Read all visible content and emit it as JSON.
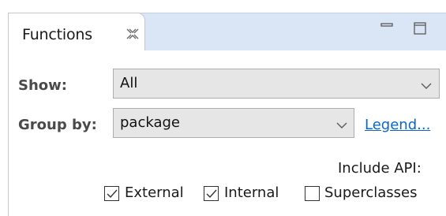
{
  "view": {
    "tab_title": "Functions",
    "close_icon": "close-x-icon",
    "minimize_icon": "minimize-icon",
    "maximize_icon": "maximize-icon"
  },
  "show": {
    "label": "Show:",
    "value": "All"
  },
  "group_by": {
    "label": "Group by:",
    "value": "package"
  },
  "legend_link": "Legend...",
  "include_api": {
    "label": "Include API:",
    "options": [
      {
        "label": "External",
        "checked": true
      },
      {
        "label": "Internal",
        "checked": true
      },
      {
        "label": "Superclasses",
        "checked": false
      }
    ]
  },
  "colors": {
    "tab_strip": "#dae6f6",
    "combo_bg": "#e6e6e6",
    "link": "#0a67c7"
  }
}
